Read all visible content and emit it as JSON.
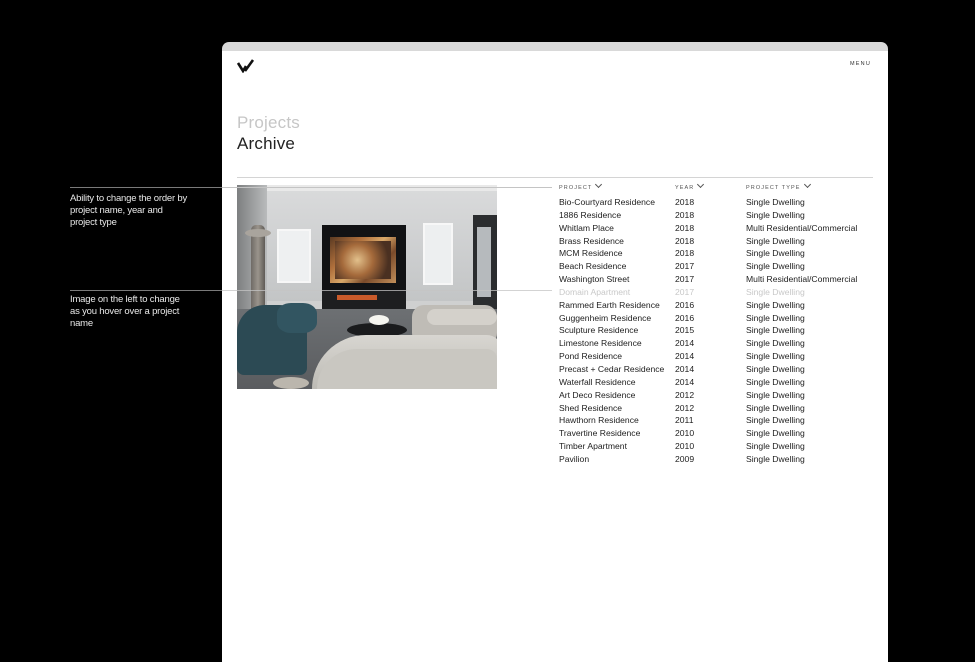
{
  "annotations": {
    "sort_note": "Ability to change the order by project name, year and project type",
    "hover_note": "Image on the left to change as you hover over a project name"
  },
  "header": {
    "logo_icon": "v-checkmark-logo-icon",
    "menu_label": "MENU"
  },
  "heading": {
    "subtitle": "Projects",
    "title": "Archive"
  },
  "preview_image": {
    "description_icon": "living-room-photo"
  },
  "table": {
    "columns": [
      {
        "label": "PROJECT",
        "icon": "chevron-down-icon"
      },
      {
        "label": "YEAR",
        "icon": "chevron-down-icon"
      },
      {
        "label": "PROJECT TYPE",
        "icon": "chevron-down-icon"
      }
    ],
    "rows": [
      {
        "name": "Bio-Courtyard Residence",
        "year": "2018",
        "type": "Single Dwelling",
        "hovered": false
      },
      {
        "name": "1886 Residence",
        "year": "2018",
        "type": "Single Dwelling",
        "hovered": false
      },
      {
        "name": "Whitlam Place",
        "year": "2018",
        "type": "Multi Residential/Commercial",
        "hovered": false
      },
      {
        "name": "Brass Residence",
        "year": "2018",
        "type": "Single Dwelling",
        "hovered": false
      },
      {
        "name": "MCM Residence",
        "year": "2018",
        "type": "Single Dwelling",
        "hovered": false
      },
      {
        "name": "Beach Residence",
        "year": "2017",
        "type": "Single Dwelling",
        "hovered": false
      },
      {
        "name": "Washington Street",
        "year": "2017",
        "type": "Multi Residential/Commercial",
        "hovered": false
      },
      {
        "name": "Domain Apartment",
        "year": "2017",
        "type": "Single Dwelling",
        "hovered": true
      },
      {
        "name": "Rammed Earth Residence",
        "year": "2016",
        "type": "Single Dwelling",
        "hovered": false
      },
      {
        "name": "Guggenheim Residence",
        "year": "2016",
        "type": "Single Dwelling",
        "hovered": false
      },
      {
        "name": "Sculpture Residence",
        "year": "2015",
        "type": "Single Dwelling",
        "hovered": false
      },
      {
        "name": "Limestone Residence",
        "year": "2014",
        "type": "Single Dwelling",
        "hovered": false
      },
      {
        "name": "Pond Residence",
        "year": "2014",
        "type": "Single Dwelling",
        "hovered": false
      },
      {
        "name": "Precast + Cedar Residence",
        "year": "2014",
        "type": "Single Dwelling",
        "hovered": false
      },
      {
        "name": "Waterfall Residence",
        "year": "2014",
        "type": "Single Dwelling",
        "hovered": false
      },
      {
        "name": "Art Deco Residence",
        "year": "2012",
        "type": "Single Dwelling",
        "hovered": false
      },
      {
        "name": "Shed Residence",
        "year": "2012",
        "type": "Single Dwelling",
        "hovered": false
      },
      {
        "name": "Hawthorn Residence",
        "year": "2011",
        "type": "Single Dwelling",
        "hovered": false
      },
      {
        "name": "Travertine Residence",
        "year": "2010",
        "type": "Single Dwelling",
        "hovered": false
      },
      {
        "name": "Timber Apartment",
        "year": "2010",
        "type": "Single Dwelling",
        "hovered": false
      },
      {
        "name": "Pavilion",
        "year": "2009",
        "type": "Single Dwelling",
        "hovered": false
      }
    ]
  },
  "colors": {
    "background": "#000000",
    "page": "#ffffff",
    "text": "#1e1e1e",
    "muted_text": "#c6c6c6"
  }
}
